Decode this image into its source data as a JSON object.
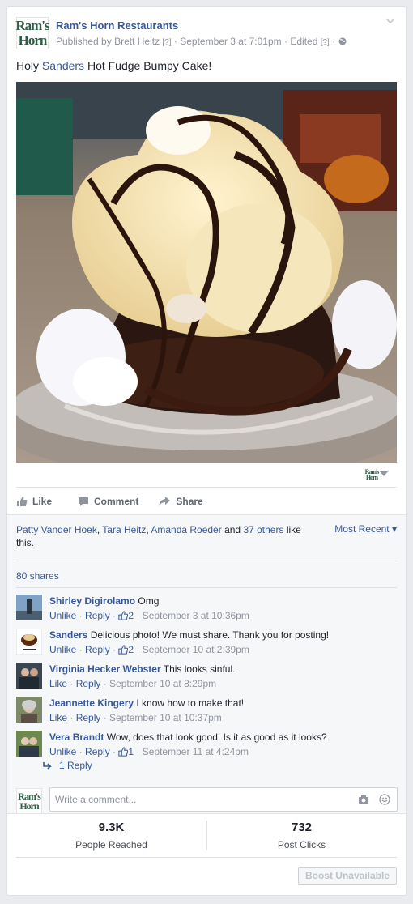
{
  "post": {
    "page_name": "Ram's Horn Restaurants",
    "logo_top": "Ram's",
    "logo_bottom": "Horn",
    "meta_prefix": "Published by",
    "publisher": "Brett Heitz",
    "help_mark": "[?]",
    "dot": "·",
    "date": "September 3 at 7:01pm",
    "edited": "Edited",
    "text_before": "Holy ",
    "text_link": "Sanders",
    "text_after": " Hot Fudge Bumpy Cake!"
  },
  "actions": {
    "like": "Like",
    "comment": "Comment",
    "share": "Share"
  },
  "reactions": {
    "liker1": "Patty Vander Hoek",
    "liker2": "Tara Heitz",
    "liker3": "Amanda Roeder",
    "sep": ", ",
    "and": " and ",
    "others": "37 others",
    "tail": " like this.",
    "sort": "Most Recent ▾",
    "shares": "80 shares"
  },
  "comments": [
    {
      "author": "Shirley Digirolamo",
      "text": "Omg",
      "unlike": "Unlike",
      "reply": "Reply",
      "likes": "2",
      "time": "September 3 at 10:36pm"
    },
    {
      "author": "Sanders",
      "text": "Delicious photo! We must share. Thank you for posting!",
      "unlike": "Unlike",
      "reply": "Reply",
      "likes": "2",
      "time": "September 10 at 2:39pm"
    },
    {
      "author": "Virginia Hecker Webster",
      "text": "This looks sinful.",
      "like": "Like",
      "reply": "Reply",
      "time": "September 10 at 8:29pm"
    },
    {
      "author": "Jeannette Kingery",
      "text": "I know how to make that!",
      "like": "Like",
      "reply": "Reply",
      "time": "September 10 at 10:37pm"
    },
    {
      "author": "Vera Brandt",
      "text": "Wow, does that look good. Is it as good as it looks?",
      "unlike": "Unlike",
      "reply": "Reply",
      "likes": "1",
      "time": "September 11 at 4:24pm"
    }
  ],
  "reply_count": "1 Reply",
  "write_placeholder": "Write a comment...",
  "stats": {
    "reached_value": "9.3K",
    "reached_label": "People Reached",
    "clicks_value": "732",
    "clicks_label": "Post Clicks"
  },
  "boost_label": "Boost Unavailable",
  "colors": {
    "link": "#365899",
    "muted": "#90949c",
    "brand_green": "#2f5d46"
  }
}
